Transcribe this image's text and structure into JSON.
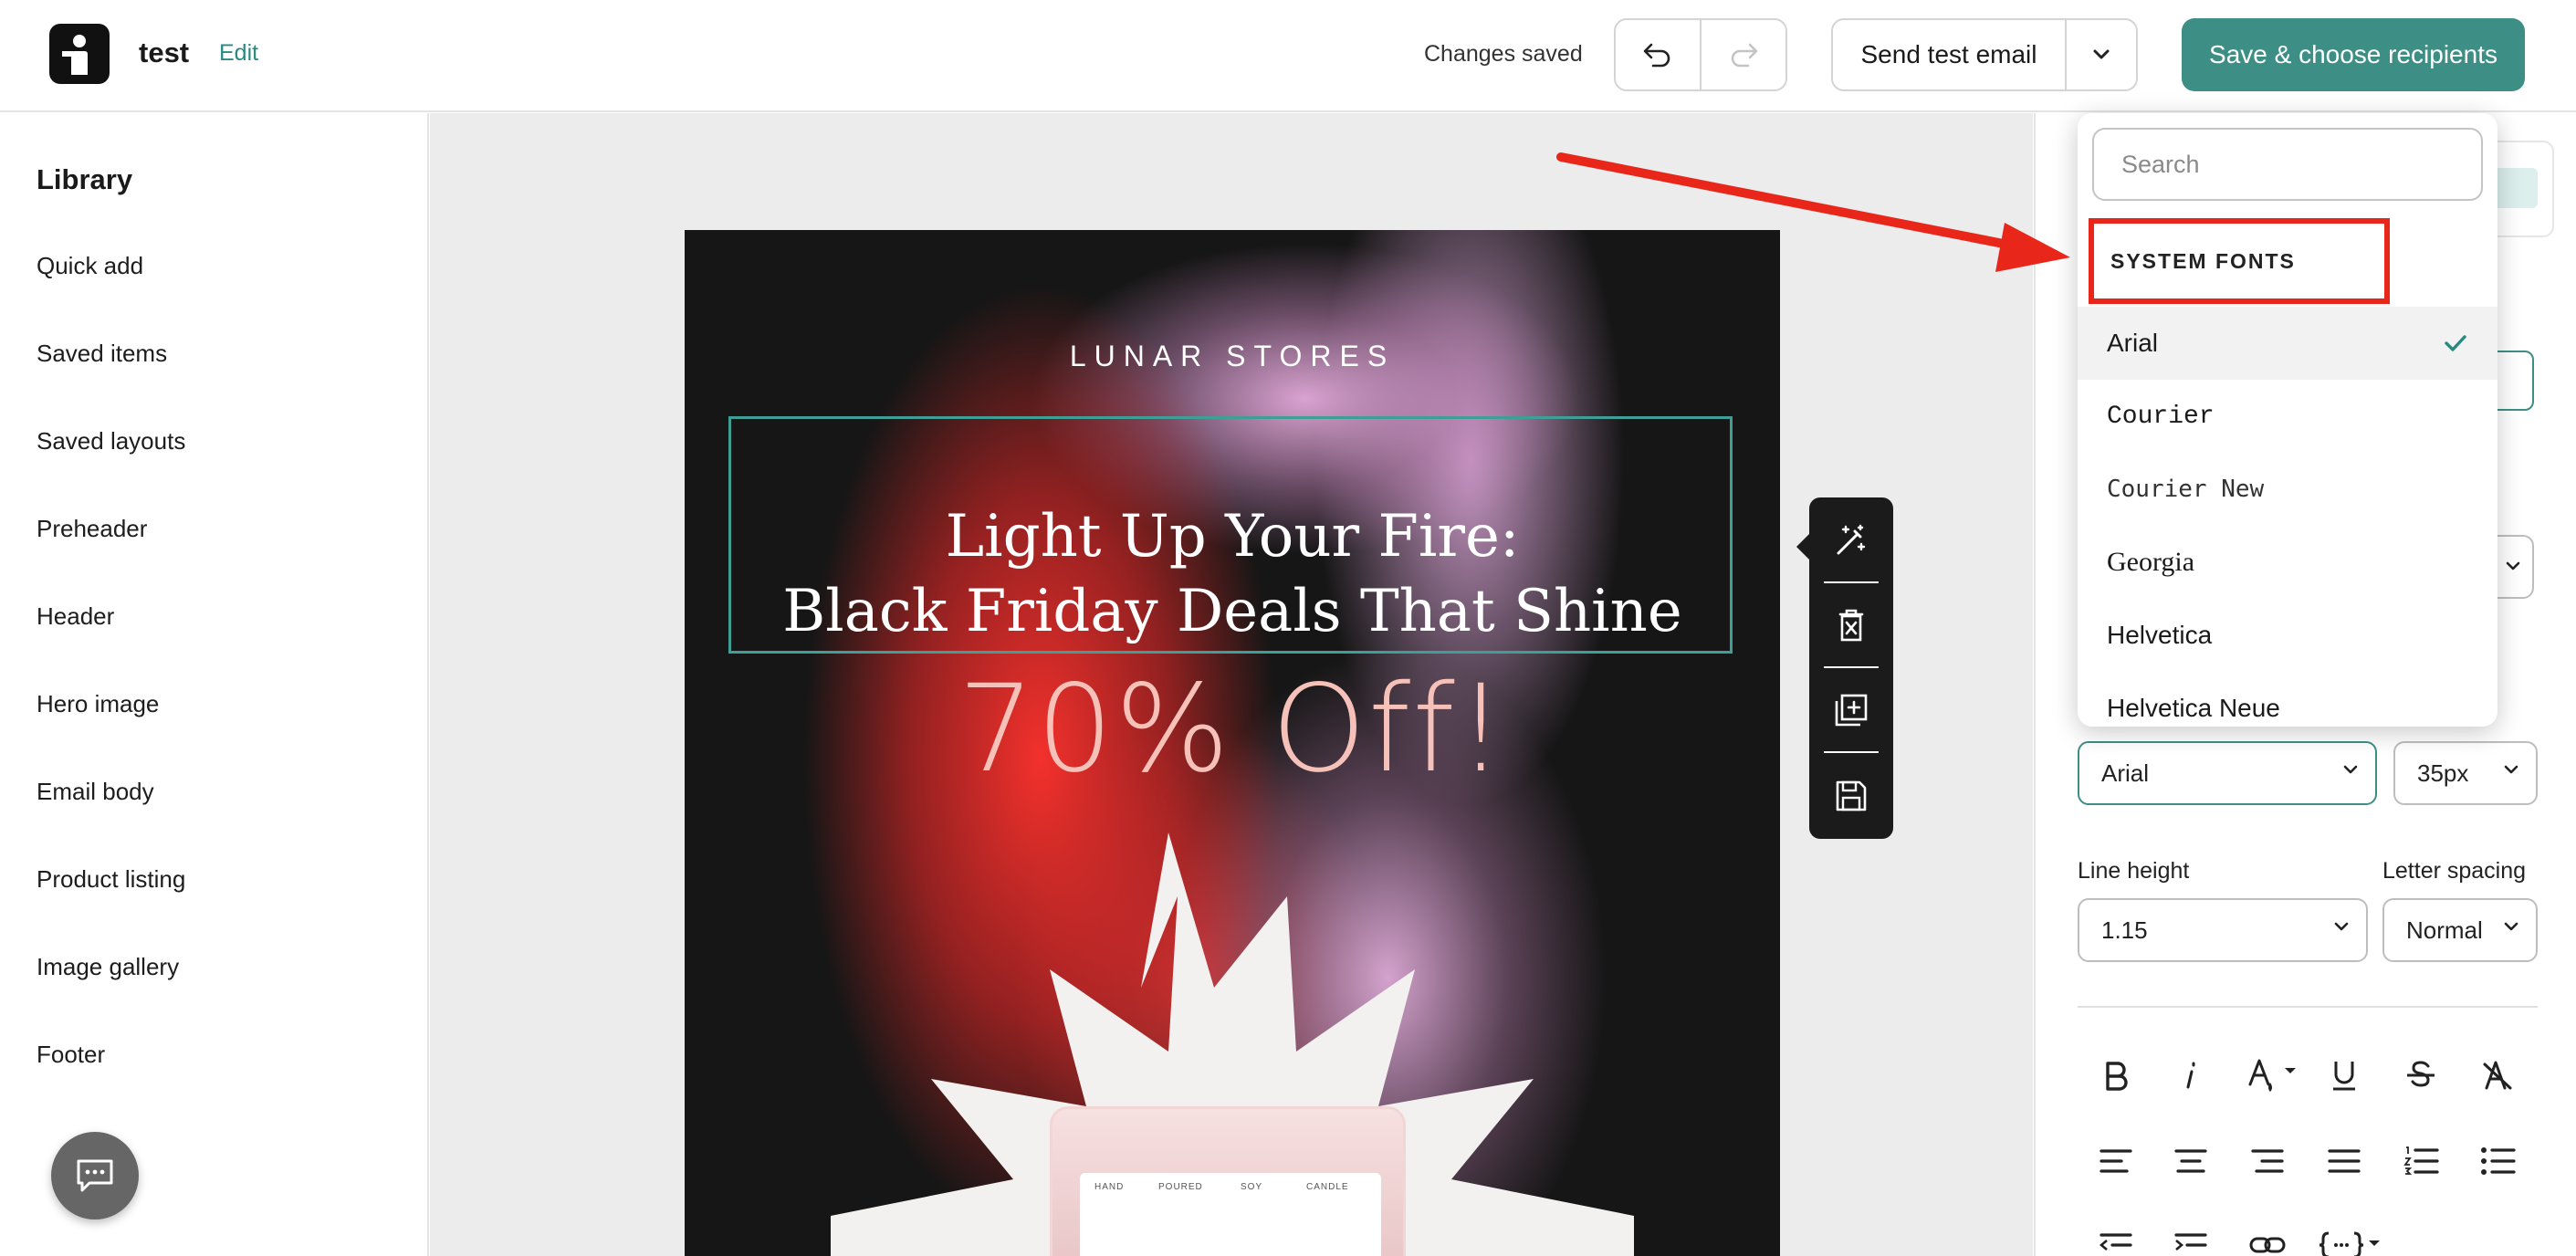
{
  "header": {
    "doc_name": "test",
    "edit_label": "Edit",
    "status": "Changes saved",
    "send_test_label": "Send test email",
    "save_label": "Save & choose recipients"
  },
  "sidebar": {
    "title": "Library",
    "items": [
      "Quick add",
      "Saved items",
      "Saved layouts",
      "Preheader",
      "Header",
      "Hero image",
      "Email body",
      "Product listing",
      "Image gallery",
      "Footer"
    ]
  },
  "email": {
    "brand": "LUNAR STORES",
    "headline_line1": "Light Up Your Fire:",
    "headline_line2": "Black Friday Deals That Shine",
    "discount": "70% Off!",
    "candle_label": [
      "HAND",
      "POURED",
      "SOY",
      "CANDLE"
    ]
  },
  "font_dropdown": {
    "search_placeholder": "Search",
    "section_title": "SYSTEM FONTS",
    "fonts": [
      "Arial",
      "Courier",
      "Courier New",
      "Georgia",
      "Helvetica",
      "Helvetica Neue"
    ],
    "selected_font": "Arial"
  },
  "text_settings": {
    "font_family": "Arial",
    "font_size": "35px",
    "line_height_label": "Line height",
    "line_height": "1.15",
    "letter_spacing_label": "Letter spacing",
    "letter_spacing": "Normal"
  },
  "colors": {
    "accent": "#3d8f86",
    "annotation": "#e8261a",
    "selection_outline": "#3f9e95"
  },
  "icons": {
    "undo": "undo-icon",
    "redo": "redo-icon",
    "ai": "magic-wand-icon",
    "delete": "delete-icon",
    "duplicate": "duplicate-icon",
    "save_block": "save-icon",
    "chat": "chat-icon"
  }
}
